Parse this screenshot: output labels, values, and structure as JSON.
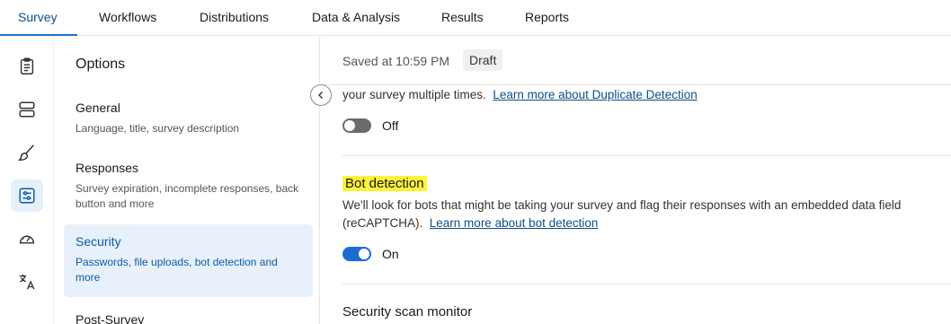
{
  "nav": {
    "tabs": [
      "Survey",
      "Workflows",
      "Distributions",
      "Data & Analysis",
      "Results",
      "Reports"
    ]
  },
  "rail": {
    "icons": [
      "clipboard-icon",
      "blocks-icon",
      "brush-icon",
      "sliders-icon",
      "gauge-icon",
      "translate-icon"
    ]
  },
  "options": {
    "title": "Options",
    "items": [
      {
        "label": "General",
        "desc": "Language, title, survey description"
      },
      {
        "label": "Responses",
        "desc": "Survey expiration, incomplete responses, back button and more"
      },
      {
        "label": "Security",
        "desc": "Passwords, file uploads, bot detection and more"
      },
      {
        "label": "Post-Survey",
        "desc": ""
      }
    ]
  },
  "status": {
    "saved": "Saved at 10:59 PM",
    "badge": "Draft"
  },
  "duplicate": {
    "text": "your survey multiple times.",
    "link": "Learn more about Duplicate Detection",
    "toggle_label": "Off"
  },
  "bot": {
    "title": "Bot detection",
    "desc": "We'll look for bots that might be taking your survey and flag their responses with an embedded data field (reCAPTCHA).",
    "link": "Learn more about bot detection",
    "toggle_label": "On"
  },
  "scan": {
    "title": "Security scan monitor"
  },
  "colors": {
    "accent": "#1a6dd0",
    "highlight": "#fff23a",
    "active_bg": "#e8f1fb"
  }
}
